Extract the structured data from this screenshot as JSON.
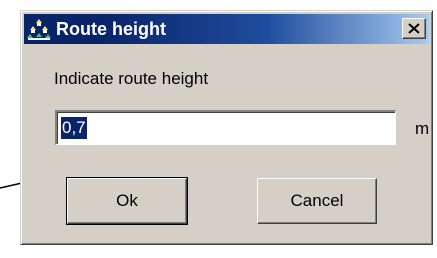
{
  "dialog": {
    "title": "Route height",
    "title_icon": "route-height-icon",
    "close_icon": "close-icon",
    "prompt": "Indicate route height",
    "input_value": "0,7",
    "unit": "m",
    "ok_label": "Ok",
    "cancel_label": "Cancel"
  },
  "colors": {
    "titlebar_start": "#0a246a",
    "titlebar_end": "#a6caf0",
    "dialog_face": "#d4d0c8",
    "selection": "#0a246a"
  }
}
